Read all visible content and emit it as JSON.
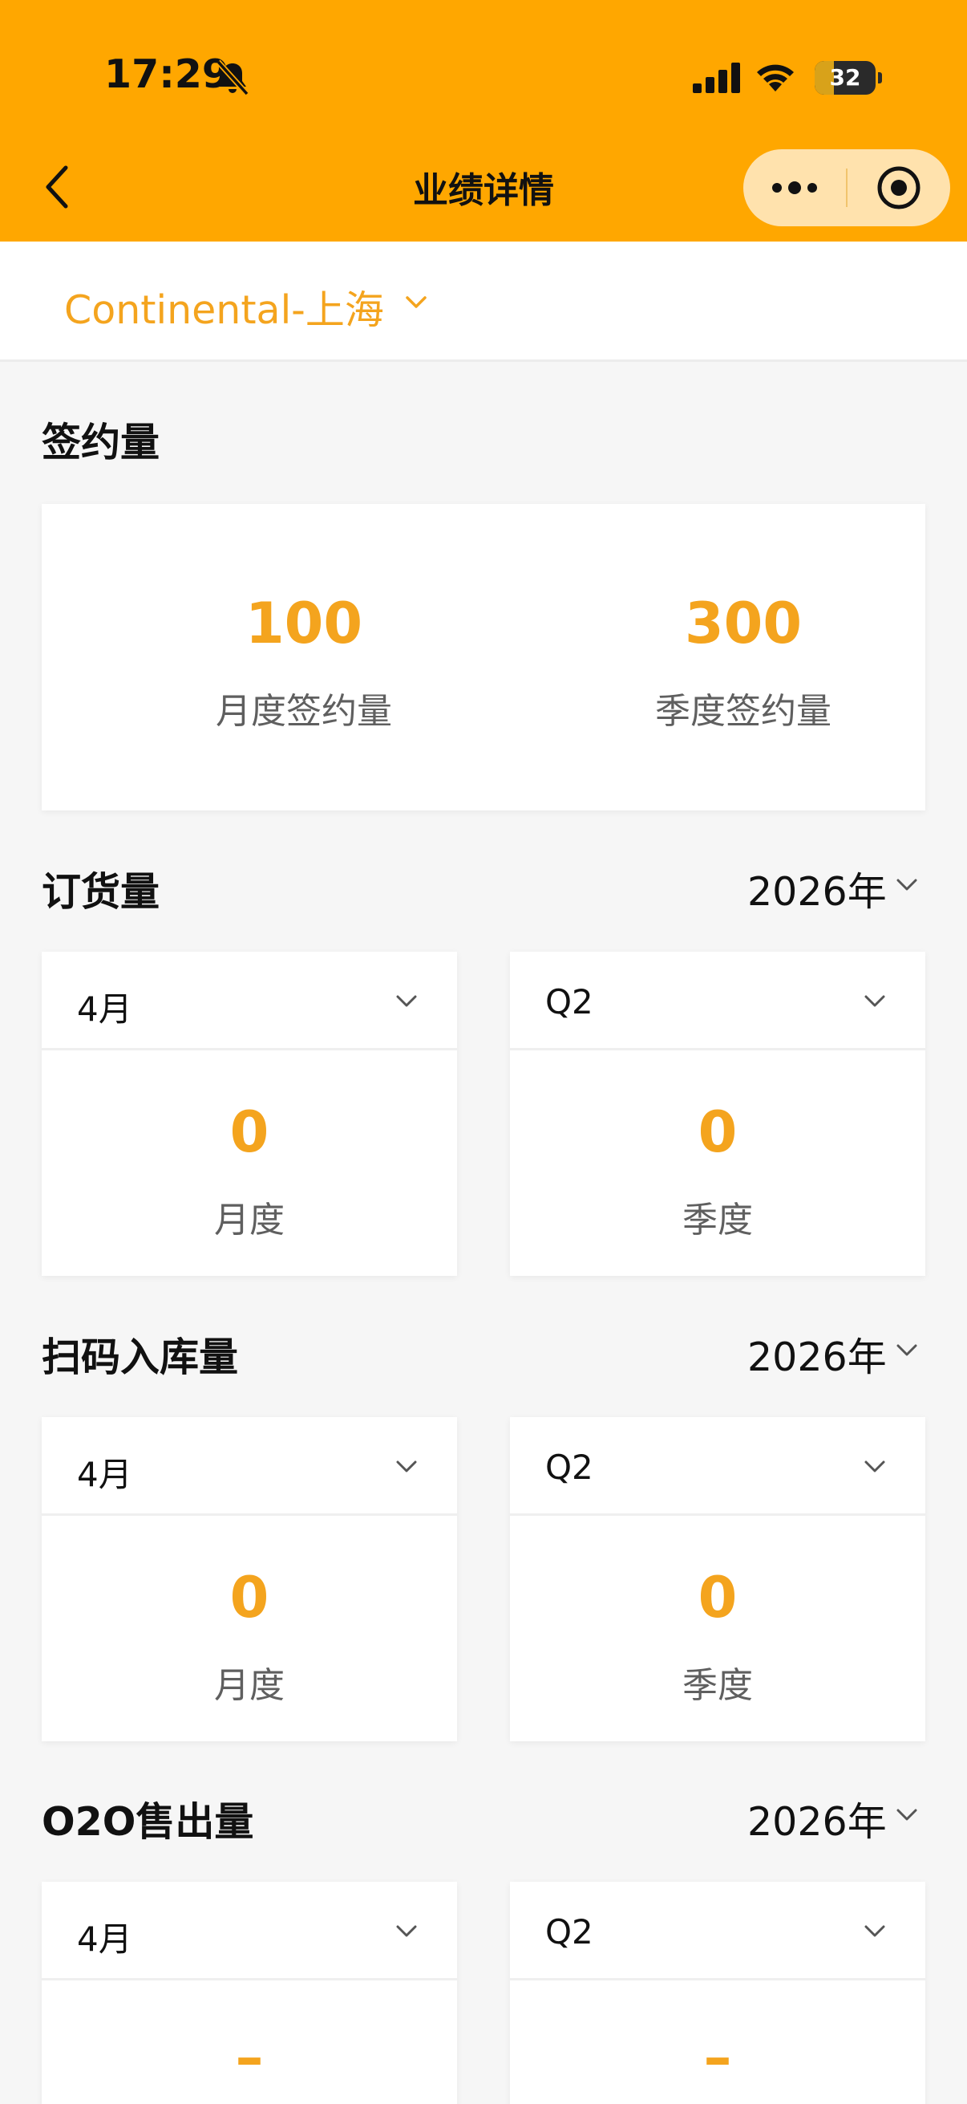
{
  "status_bar": {
    "time": "17:29",
    "battery_level": "32"
  },
  "nav": {
    "title": "业绩详情"
  },
  "store": {
    "name": "Continental-上海"
  },
  "signing": {
    "title": "签约量",
    "monthly_value": "100",
    "monthly_label": "月度签约量",
    "quarterly_value": "300",
    "quarterly_label": "季度签约量"
  },
  "orders": {
    "title": "订货量",
    "year": "2026年",
    "month_select": "4月",
    "quarter_select": "Q2",
    "monthly_value": "0",
    "monthly_label": "月度",
    "quarterly_value": "0",
    "quarterly_label": "季度"
  },
  "scan_inbound": {
    "title": "扫码入库量",
    "year": "2026年",
    "month_select": "4月",
    "quarter_select": "Q2",
    "monthly_value": "0",
    "monthly_label": "月度",
    "quarterly_value": "0",
    "quarterly_label": "季度"
  },
  "o2o_sales": {
    "title": "O2O售出量",
    "year": "2026年",
    "month_select": "4月",
    "quarter_select": "Q2",
    "monthly_value": "–",
    "quarterly_value": "–"
  },
  "colors": {
    "header_bg": "#ffa700",
    "accent": "#f4a41e",
    "capsule_bg": "#ffe2ad"
  }
}
